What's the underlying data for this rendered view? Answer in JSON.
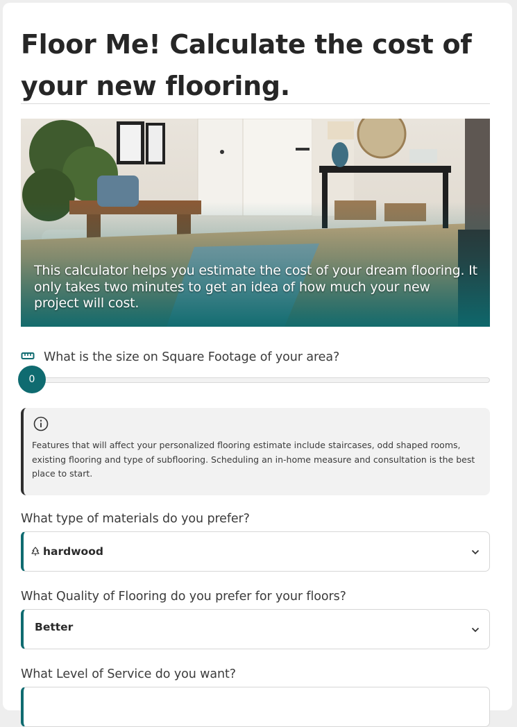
{
  "header": {
    "title": "Floor Me! Calculate the cost of your new flooring."
  },
  "hero": {
    "image_name": "living-room-hardwood-floor",
    "description_text": "This calculator helps you estimate the cost of your dream flooring. It only takes two minutes to get an idea of how much your new project will cost."
  },
  "square_footage": {
    "icon": "ruler-icon",
    "question": "What is the size on Square Footage of your area?",
    "value": "0",
    "level": 0
  },
  "info": {
    "icon": "info-icon",
    "text": "Features that will affect your personalized flooring estimate include staircases, odd shaped rooms, existing flooring and type of subflooring. Scheduling an in-home measure and consultation is the best place to start."
  },
  "materials": {
    "question": "What type of materials do you prefer?",
    "icon": "tree-icon",
    "selected": "hardwood"
  },
  "quality": {
    "question": "What Quality of Flooring do you prefer for your floors?",
    "selected": "Better"
  },
  "service": {
    "question": "What Level of Service do you want?",
    "selected": ""
  },
  "colors": {
    "accent": "#0f6b70",
    "info_border": "#2f2f2f",
    "info_bg": "#f2f2f2"
  }
}
